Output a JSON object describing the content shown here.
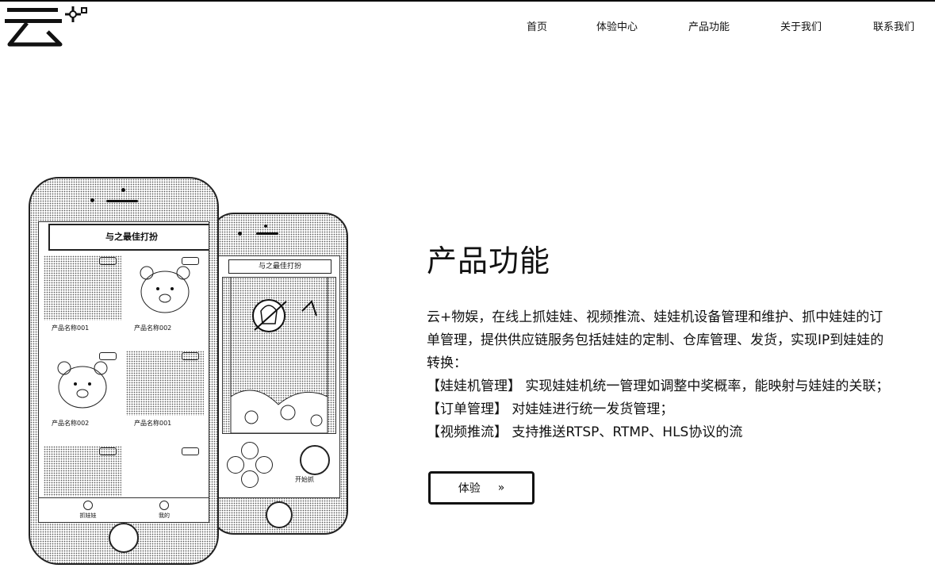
{
  "header": {
    "logo_text": "云+",
    "nav": [
      "首页",
      "体验中心",
      "产品功能",
      "关于我们",
      "联系我们"
    ]
  },
  "phone_back": {
    "title": "与之最佳打扮",
    "grab_label": "开始抓"
  },
  "phone_front": {
    "title": "与之最佳打扮",
    "products": [
      {
        "name": "产品名称001"
      },
      {
        "name": "产品名称002"
      },
      {
        "name": "产品名称002"
      },
      {
        "name": "产品名称001"
      }
    ],
    "tabs": [
      "抓娃娃",
      "我的"
    ]
  },
  "main": {
    "title": "产品功能",
    "description": [
      "云+物娱，在线上抓娃娃、视频推流、娃娃机设备管理和维护、抓中娃娃的订",
      "单管理，提供供应链服务包括娃娃的定制、仓库管理、发货，实现IP到娃娃的",
      "转换："
    ],
    "features": [
      "【娃娃机管理】 实现娃娃机统一管理如调整中奖概率，能映射与娃娃的关联；",
      "【订单管理】 对娃娃进行统一发货管理；",
      "【视频推流】 支持推送RTSP、RTMP、HLS协议的流"
    ],
    "cta_label": "体验",
    "cta_arrow": "»"
  }
}
